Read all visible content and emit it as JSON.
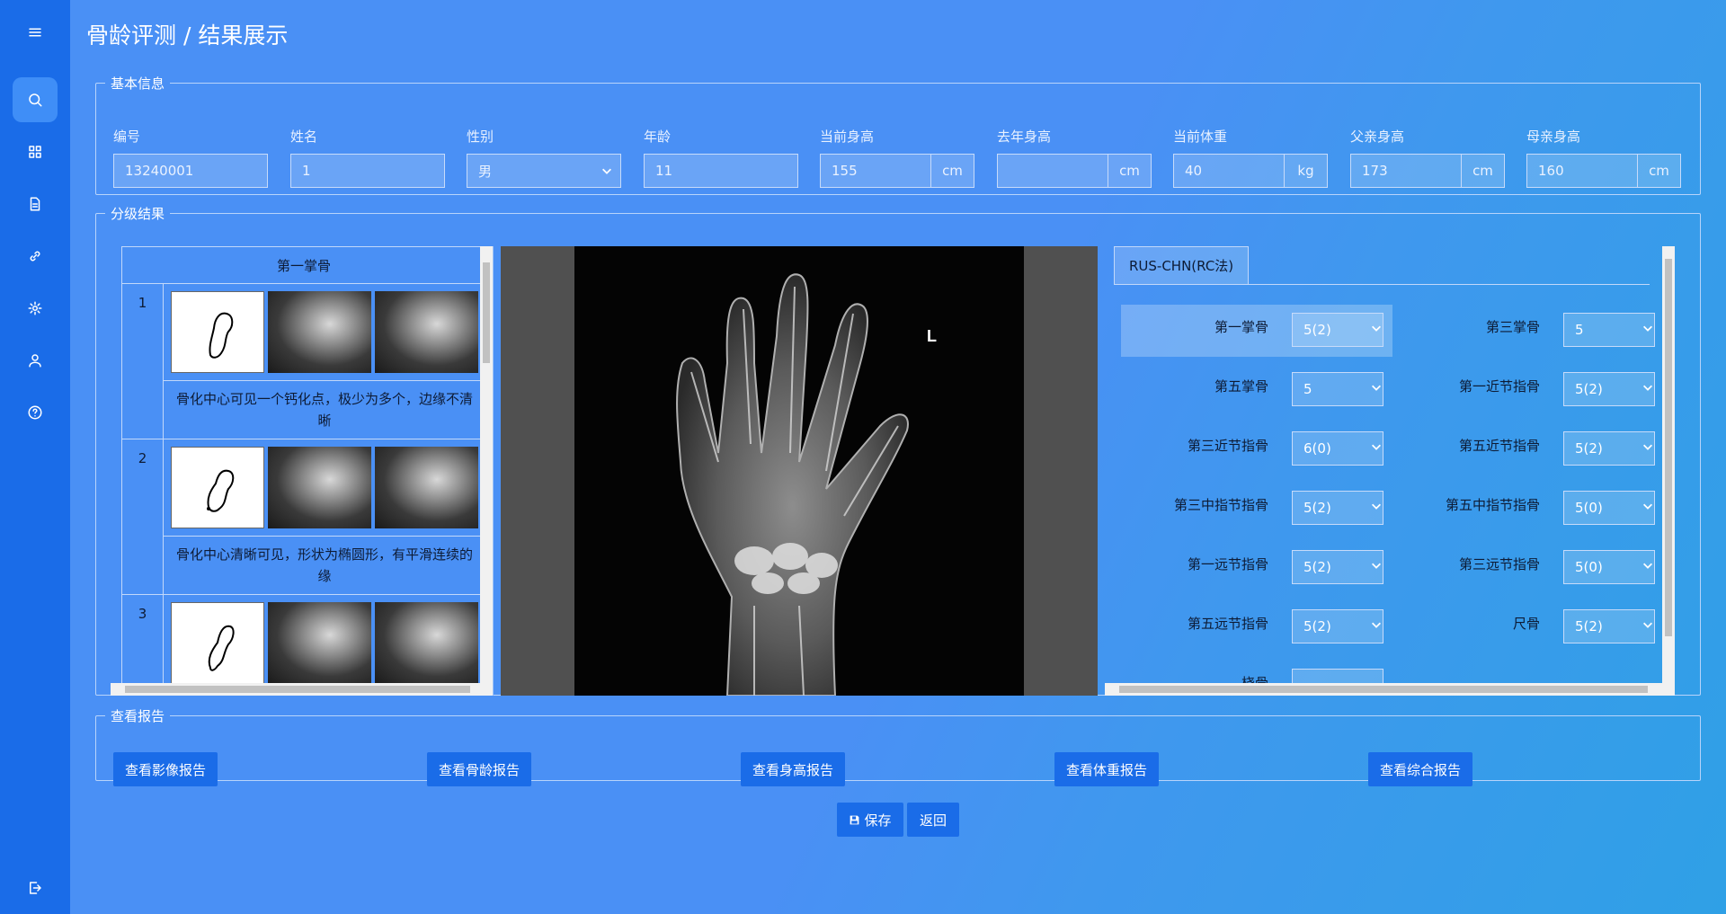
{
  "page": {
    "title": "骨龄评测 / 结果展示"
  },
  "sidebar": {
    "icons": [
      "menu-icon",
      "search-icon",
      "grid-icon",
      "document-icon",
      "link-icon",
      "gear-icon",
      "user-icon",
      "help-icon",
      "logout-icon"
    ]
  },
  "basic_info": {
    "legend": "基本信息",
    "fields": [
      {
        "label": "编号",
        "value": "13240001",
        "unit": ""
      },
      {
        "label": "姓名",
        "value": "1",
        "unit": ""
      },
      {
        "label": "性别",
        "value": "男",
        "unit": ""
      },
      {
        "label": "年龄",
        "value": "11",
        "unit": ""
      },
      {
        "label": "当前身高",
        "value": "155",
        "unit": "cm"
      },
      {
        "label": "去年身高",
        "value": "",
        "unit": "cm"
      },
      {
        "label": "当前体重",
        "value": "40",
        "unit": "kg"
      },
      {
        "label": "父亲身高",
        "value": "173",
        "unit": "cm"
      },
      {
        "label": "母亲身高",
        "value": "160",
        "unit": "cm"
      }
    ]
  },
  "grading": {
    "legend": "分级结果",
    "table_title": "第一掌骨",
    "rows": [
      {
        "num": "1",
        "desc": "骨化中心可见一个钙化点，极少为多个，边缘不清晰"
      },
      {
        "num": "2",
        "desc": "骨化中心清晰可见，形状为椭圆形，有平滑连续的缘"
      },
      {
        "num": "3",
        "desc": ""
      }
    ],
    "xray_marker": "L",
    "method_tab": "RUS-CHN(RC法)",
    "grades": [
      {
        "label": "第一掌骨",
        "value": "5(2)"
      },
      {
        "label": "第三掌骨",
        "value": "5"
      },
      {
        "label": "第五掌骨",
        "value": "5"
      },
      {
        "label": "第一近节指骨",
        "value": "5(2)"
      },
      {
        "label": "第三近节指骨",
        "value": "6(0)"
      },
      {
        "label": "第五近节指骨",
        "value": "5(2)"
      },
      {
        "label": "第三中指节指骨",
        "value": "5(2)"
      },
      {
        "label": "第五中指节指骨",
        "value": "5(0)"
      },
      {
        "label": "第一远节指骨",
        "value": "5(2)"
      },
      {
        "label": "第三远节指骨",
        "value": "5(0)"
      },
      {
        "label": "第五远节指骨",
        "value": "5(2)"
      },
      {
        "label": "尺骨",
        "value": "5(2)"
      },
      {
        "label": "桡骨",
        "value": ""
      }
    ]
  },
  "reports": {
    "legend": "查看报告",
    "buttons": [
      "查看影像报告",
      "查看骨龄报告",
      "查看身高报告",
      "查看体重报告",
      "查看综合报告"
    ]
  },
  "actions": {
    "save": "保存",
    "back": "返回"
  }
}
